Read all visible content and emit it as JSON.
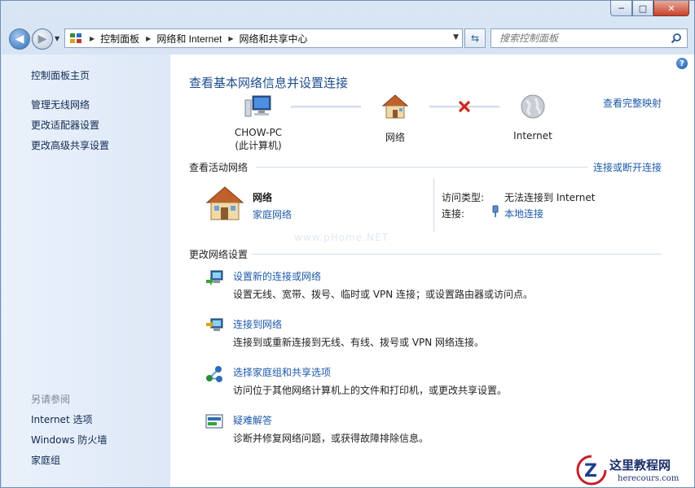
{
  "window": {
    "minimize": "─",
    "maximize": "□",
    "close": "✕"
  },
  "nav": {
    "back_icon": "back-arrow-icon",
    "forward_icon": "forward-arrow-icon",
    "crumbs": [
      "控制面板",
      "网络和 Internet",
      "网络和共享中心"
    ],
    "refresh_icon": "refresh-icon",
    "search_placeholder": "搜索控制面板"
  },
  "sidebar": {
    "home": "控制面板主页",
    "tasks": [
      "管理无线网络",
      "更改适配器设置",
      "更改高级共享设置"
    ],
    "see_also_heading": "另请参阅",
    "see_also": [
      "Internet 选项",
      "Windows 防火墙",
      "家庭组"
    ]
  },
  "main": {
    "title": "查看基本网络信息并设置连接",
    "view_full_map": "查看完整映射",
    "map": {
      "computer_name": "CHOW-PC",
      "computer_sub": "(此计算机)",
      "network": "网络",
      "internet": "Internet",
      "link_status": "disconnected"
    },
    "active_networks": {
      "heading": "查看活动网络",
      "connect_disconnect": "连接或断开连接",
      "network_name": "网络",
      "network_type": "家庭网络",
      "access_type_label": "访问类型:",
      "access_type_value": "无法连接到 Internet",
      "connections_label": "连接:",
      "connections_value": "本地连接"
    },
    "change_settings": {
      "heading": "更改网络设置",
      "tasks": [
        {
          "link": "设置新的连接或网络",
          "desc": "设置无线、宽带、拨号、临时或 VPN 连接；或设置路由器或访问点。"
        },
        {
          "link": "连接到网络",
          "desc": "连接到或重新连接到无线、有线、拨号或 VPN 网络连接。"
        },
        {
          "link": "选择家庭组和共享选项",
          "desc": "访问位于其他网络计算机上的文件和打印机，或更改共享设置。"
        },
        {
          "link": "疑难解答",
          "desc": "诊断并修复网络问题，或获得故障排除信息。"
        }
      ]
    },
    "watermark": "www.pHome.NET"
  },
  "brand": {
    "name": "这里教程网",
    "url": "herecours.com"
  },
  "colors": {
    "link": "#1e5aa8",
    "title": "#1e4e8c",
    "sidebar_bg": "#e3ecf8",
    "error": "#d0241c"
  }
}
